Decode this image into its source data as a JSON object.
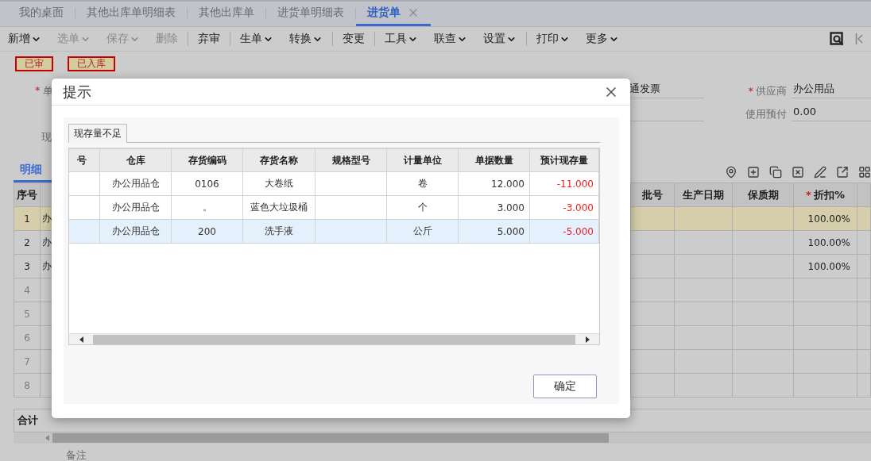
{
  "tabs": [
    {
      "label": "我的桌面",
      "selected": false,
      "closable": false
    },
    {
      "label": "其他出库单明细表",
      "selected": false,
      "closable": false
    },
    {
      "label": "其他出库单",
      "selected": false,
      "closable": false
    },
    {
      "label": "进货单明细表",
      "selected": false,
      "closable": false
    },
    {
      "label": "进货单",
      "selected": true,
      "closable": true
    }
  ],
  "toolbar": [
    {
      "label": "新增",
      "disabled": false,
      "dropdown": true,
      "divider_before": false
    },
    {
      "label": "选单",
      "disabled": true,
      "dropdown": true,
      "divider_before": false
    },
    {
      "label": "保存",
      "disabled": true,
      "dropdown": true,
      "divider_before": false
    },
    {
      "label": "删除",
      "disabled": true,
      "dropdown": false,
      "divider_before": false
    },
    {
      "label": "弃审",
      "disabled": false,
      "dropdown": false,
      "divider_before": true
    },
    {
      "label": "生单",
      "disabled": false,
      "dropdown": true,
      "divider_before": true
    },
    {
      "label": "转换",
      "disabled": false,
      "dropdown": true,
      "divider_before": false
    },
    {
      "label": "变更",
      "disabled": false,
      "dropdown": false,
      "divider_before": true
    },
    {
      "label": "工具",
      "disabled": false,
      "dropdown": true,
      "divider_before": true
    },
    {
      "label": "联查",
      "disabled": false,
      "dropdown": true,
      "divider_before": false
    },
    {
      "label": "设置",
      "disabled": false,
      "dropdown": true,
      "divider_before": false
    },
    {
      "label": "打印",
      "disabled": false,
      "dropdown": true,
      "divider_before": true
    },
    {
      "label": "更多",
      "disabled": false,
      "dropdown": true,
      "divider_before": false
    }
  ],
  "status_badges": [
    "已审",
    "已入库"
  ],
  "form": {
    "doc_label": "单",
    "doc_mark": "*",
    "invoice_value": "通发票",
    "supplier_label": "供应商",
    "supplier_mark": "*",
    "supplier_value": "办公用品",
    "prepay_label": "使用预付",
    "prepay_value": "0.00",
    "stock_label": "现"
  },
  "detail_tab": {
    "label": "明细",
    "selected": true
  },
  "grid": {
    "columns": [
      {
        "label": "序号"
      },
      {
        "label": "批号"
      },
      {
        "label": "生产日期"
      },
      {
        "label": "保质期"
      },
      {
        "label": "折扣%",
        "mark": "*"
      }
    ],
    "rows": [
      {
        "no": "1",
        "item": "办",
        "discount": "100.00%",
        "selected": true,
        "filled": true
      },
      {
        "no": "2",
        "item": "办",
        "discount": "100.00%",
        "selected": false,
        "filled": true
      },
      {
        "no": "3",
        "item": "办",
        "discount": "100.00%",
        "selected": false,
        "filled": true
      },
      {
        "no": "4",
        "selected": false,
        "filled": false
      },
      {
        "no": "5",
        "selected": false,
        "filled": false
      },
      {
        "no": "6",
        "selected": false,
        "filled": false
      },
      {
        "no": "7",
        "selected": false,
        "filled": false
      },
      {
        "no": "8",
        "selected": false,
        "filled": false
      }
    ],
    "total_label": "合计"
  },
  "remark_label": "备注",
  "dialog": {
    "title": "提示",
    "tab": "现存量不足",
    "columns": [
      "号",
      "仓库",
      "存货编码",
      "存货名称",
      "规格型号",
      "计量单位",
      "单据数量",
      "预计现存量"
    ],
    "rows": [
      {
        "warehouse": "办公用品仓",
        "code": "0106",
        "name": "大卷纸",
        "unit": "卷",
        "qty": "12.000",
        "forecast": "-11.000",
        "selected": false
      },
      {
        "warehouse": "办公用品仓",
        "code": "。",
        "name": "蓝色大垃圾桶",
        "unit": "个",
        "qty": "3.000",
        "forecast": "-3.000",
        "selected": false
      },
      {
        "warehouse": "办公用品仓",
        "code": "200",
        "name": "洗手液",
        "unit": "公斤",
        "qty": "5.000",
        "forecast": "-5.000",
        "selected": true
      }
    ],
    "ok_button": "确定"
  }
}
